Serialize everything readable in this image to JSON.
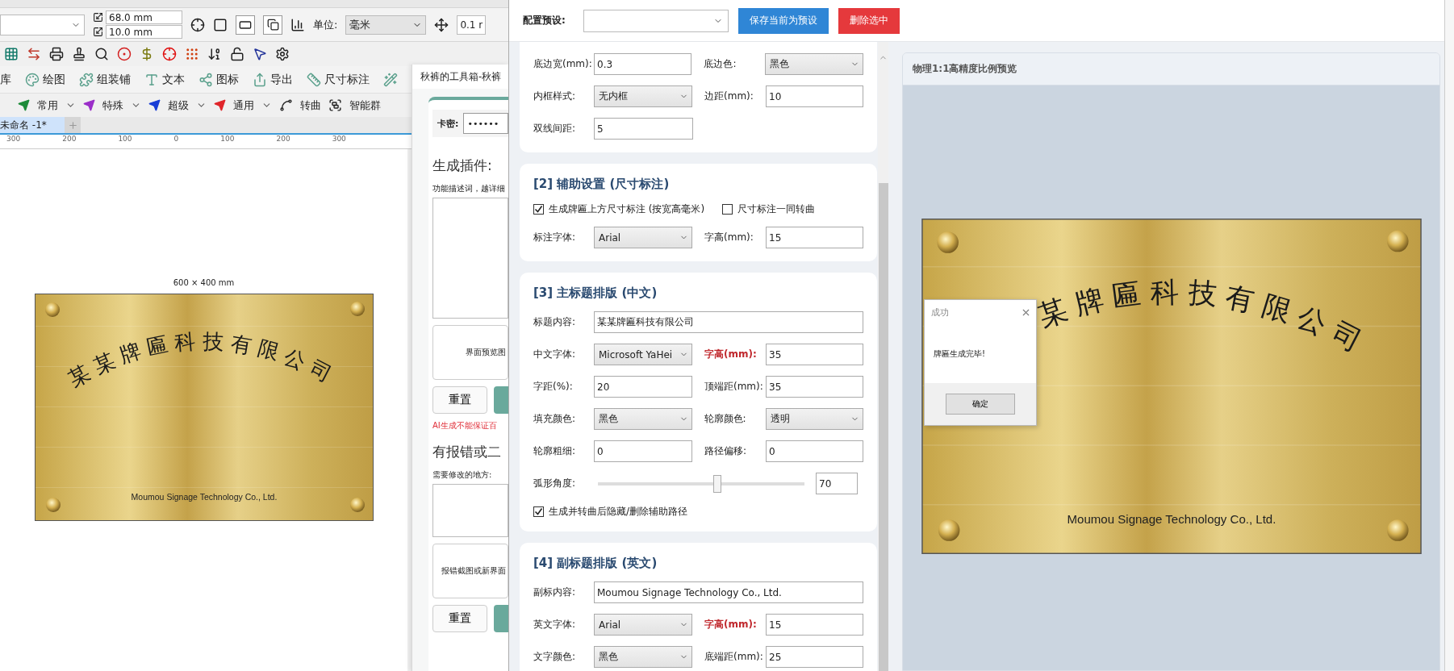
{
  "app": {
    "property_bar": {
      "width": "68.0 mm",
      "height": "10.0 mm",
      "unit_label": "单位:",
      "unit": "毫米",
      "nudge": "0.1 r"
    },
    "menu": [
      {
        "label": "库",
        "kind": "none"
      },
      {
        "label": "绘图",
        "kind": "palette"
      },
      {
        "label": "组装铺",
        "kind": "puzzle"
      },
      {
        "label": "文本",
        "kind": "text"
      },
      {
        "label": "图标",
        "kind": "nodes"
      },
      {
        "label": "导出",
        "kind": "export"
      },
      {
        "label": "尺寸标注",
        "kind": "ruler"
      },
      {
        "kind": "wand"
      }
    ],
    "quick_tools": [
      {
        "label": "常用",
        "kind": "plane",
        "color": "#1e8c3a",
        "dropdown": true
      },
      {
        "label": "特殊",
        "kind": "plane",
        "color": "#9b2fc9",
        "dropdown": true
      },
      {
        "label": "超级",
        "kind": "plane",
        "color": "#1a3fd6",
        "dropdown": true
      },
      {
        "label": "通用",
        "kind": "plane",
        "color": "#e0262b",
        "dropdown": true
      },
      {
        "label": "转曲",
        "kind": "curve",
        "dropdown": false
      },
      {
        "label": "智能群",
        "kind": "group",
        "dropdown": false
      }
    ],
    "document_tab": "未命名 -1*",
    "ruler": [
      "300",
      "200",
      "100",
      "0",
      "100",
      "200",
      "300"
    ],
    "plate": {
      "dimension": "600 × 400 mm",
      "title": "某某牌匾科技有限公司",
      "subtitle": "Moumou Signage Technology Co., Ltd."
    }
  },
  "plugin_window": {
    "title": "秋裤的工具箱-秋裤",
    "key_label": "卡密:",
    "key_value": "••••••",
    "sections": [
      {
        "heading": "生成插件:",
        "prompt_label": "功能描述词，越详细",
        "drop_hint": "界面预览图",
        "reset": "重置",
        "warning": "AI生成不能保证百"
      },
      {
        "heading": "有报错或二",
        "prompt_label": "需要修改的地方:",
        "drop_hint": "报错截图或新界面",
        "reset": "重置"
      }
    ]
  },
  "sign_dialog": {
    "preset_label": "配置预设:",
    "save_button": "保存当前为预设",
    "delete_button": "删除选中",
    "cards": [
      {
        "rows": [
          [
            {
              "kind": "text",
              "label": "底边宽(mm):",
              "value": "0.3",
              "highlight": false
            },
            {
              "kind": "select",
              "label": "底边色:",
              "value": "黑色",
              "highlight": false
            }
          ],
          [
            {
              "kind": "select",
              "label": "内框样式:",
              "value": "无内框",
              "highlight": false
            },
            {
              "kind": "text",
              "label": "边距(mm):",
              "value": "10",
              "highlight": false
            }
          ],
          [
            {
              "kind": "text",
              "label": "双线间距:",
              "value": "5",
              "highlight": false
            }
          ]
        ]
      },
      {
        "heading": "[2] 辅助设置 (尺寸标注)",
        "rows": [
          [
            {
              "kind": "checkbox",
              "label": "生成牌匾上方尺寸标注 (按宽高毫米)",
              "checked": true
            },
            {
              "kind": "checkbox",
              "label": "尺寸标注一同转曲",
              "checked": false
            }
          ],
          [
            {
              "kind": "select",
              "label": "标注字体:",
              "value": "Arial",
              "highlight": false
            },
            {
              "kind": "text",
              "label": "字高(mm):",
              "value": "15",
              "highlight": false
            }
          ]
        ]
      },
      {
        "heading": "[3] 主标题排版 (中文)",
        "rows": [
          [
            {
              "kind": "wide",
              "label": "标题内容:",
              "value": "某某牌匾科技有限公司",
              "highlight": false
            }
          ],
          [
            {
              "kind": "select",
              "label": "中文字体:",
              "value": "Microsoft YaHei",
              "highlight": false
            },
            {
              "kind": "text",
              "label": "字高(mm):",
              "value": "35",
              "highlight": true
            }
          ],
          [
            {
              "kind": "text",
              "label": "字距(%):",
              "value": "20",
              "highlight": false
            },
            {
              "kind": "text",
              "label": "顶端距(mm):",
              "value": "35",
              "highlight": false
            }
          ],
          [
            {
              "kind": "select",
              "label": "填充颜色:",
              "value": "黑色",
              "highlight": false
            },
            {
              "kind": "select",
              "label": "轮廓颜色:",
              "value": "透明",
              "highlight": false
            }
          ],
          [
            {
              "kind": "text",
              "label": "轮廓粗细:",
              "value": "0",
              "highlight": false
            },
            {
              "kind": "text",
              "label": "路径偏移:",
              "value": "0",
              "highlight": false
            }
          ],
          [
            {
              "kind": "slider",
              "label": "弧形角度:",
              "level": 0.58,
              "value": "70"
            }
          ],
          [
            {
              "kind": "checkbox",
              "label": "生成并转曲后隐藏/删除辅助路径",
              "checked": true
            }
          ]
        ]
      },
      {
        "heading": "[4] 副标题排版 (英文)",
        "rows": [
          [
            {
              "kind": "wide",
              "label": "副标内容:",
              "value": "Moumou Signage Technology Co., Ltd.",
              "highlight": false
            }
          ],
          [
            {
              "kind": "select",
              "label": "英文字体:",
              "value": "Arial",
              "highlight": false
            },
            {
              "kind": "text",
              "label": "字高(mm):",
              "value": "15",
              "highlight": true
            }
          ],
          [
            {
              "kind": "select",
              "label": "文字颜色:",
              "value": "黑色",
              "highlight": false
            },
            {
              "kind": "text",
              "label": "底端距(mm):",
              "value": "25",
              "highlight": false
            }
          ]
        ]
      }
    ],
    "preview": {
      "title": "物理1:1高精度比例预览",
      "plate": {
        "title": "某牌匾科技有限公司",
        "subtitle": "Moumou Signage Technology Co., Ltd."
      }
    },
    "message_box": {
      "title": "成功",
      "message": "牌匾生成完毕!",
      "ok": "确定"
    }
  }
}
